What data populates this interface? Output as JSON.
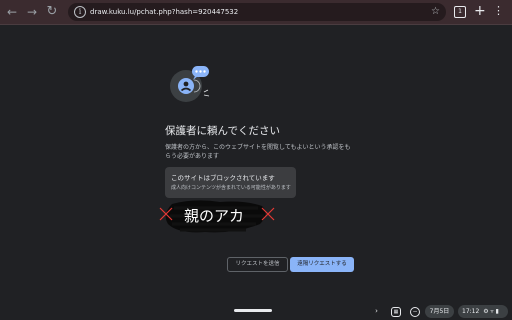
{
  "browser": {
    "url": "draw.kuku.lu/pchat.php?hash=920447532",
    "tab_count": "1",
    "back_icon": "arrow-left-icon",
    "forward_icon": "arrow-right-icon",
    "reload_icon": "reload-icon",
    "colors": {
      "toolbar": "#3b2b2f",
      "omnibox": "#251b1e",
      "page": "#202124"
    }
  },
  "page": {
    "title": "保護者に頼んでください",
    "description": "保護者の方から、このウェブサイトを閲覧してもよいという承認をもらう必要があります",
    "card_title": "このサイトはブロックされています",
    "card_subtitle": "成人向けコンテンツが含まれている可能性があります",
    "handwriting": "親のアカ",
    "btn_send": "リクエストを送信",
    "btn_remote": "遠隔リクエストする",
    "colors": {
      "primary_button": "#8ab4f8",
      "card": "#3c3d40",
      "cross_marks": "#e53935"
    }
  },
  "shelf": {
    "date": "7月5日",
    "time": "17:12"
  }
}
